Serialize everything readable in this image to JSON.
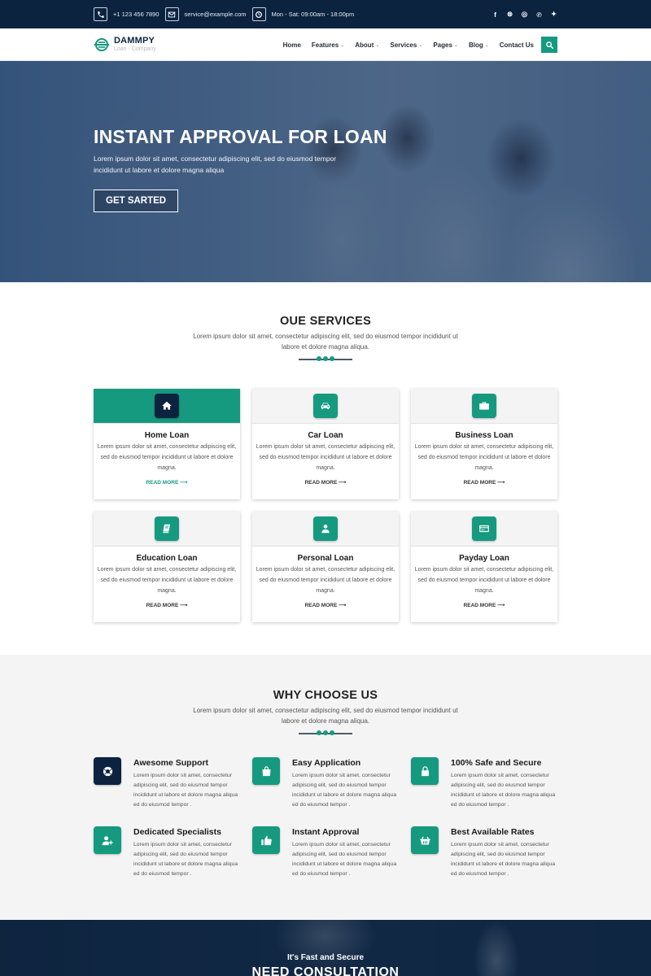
{
  "topbar": {
    "phone": "+1 123 456 7890",
    "email": "service@example.com",
    "hours": "Mon - Sat: 09:00am - 18:00pm",
    "socials": [
      {
        "name": "facebook",
        "glyph": "f"
      },
      {
        "name": "dribbble",
        "glyph": "⊗"
      },
      {
        "name": "instagram",
        "glyph": "◎"
      },
      {
        "name": "pinterest",
        "glyph": "℗"
      },
      {
        "name": "twitter",
        "glyph": "✦"
      }
    ]
  },
  "nav": {
    "brand": "DAMMPY",
    "tagline": "Loan - Company",
    "items": [
      {
        "label": "Home",
        "dropdown": false
      },
      {
        "label": "Features",
        "dropdown": true
      },
      {
        "label": "About",
        "dropdown": true
      },
      {
        "label": "Services",
        "dropdown": true
      },
      {
        "label": "Pages",
        "dropdown": true
      },
      {
        "label": "Blog",
        "dropdown": true
      },
      {
        "label": "Contact Us",
        "dropdown": false
      }
    ],
    "caret": "⌄"
  },
  "hero": {
    "title": "INSTANT APPROVAL FOR LOAN",
    "text": "Lorem ipsum dolor sit amet, consectetur adipiscing elit, sed do eiusmod tempor incididunt ut labore et dolore magna aliqua",
    "cta": "GET SARTED"
  },
  "services": {
    "title": "OUE SERVICES",
    "text": "Lorem ipsum dolor sit amet, consectetur adipiscing elit, sed do eiusmod tempor incididunt ut labore et dolore magna aliqua.",
    "read_more": "READ MORE  ⟶",
    "cards": [
      {
        "title": "Home Loan",
        "icon": "home-icon",
        "active": true,
        "text": "Lorem ipsum dolor sit amet, consectetur adipiscing elit, sed do eiusmod tempor incididunt ut labore et dolore magna."
      },
      {
        "title": "Car Loan",
        "icon": "car-icon",
        "active": false,
        "text": "Lorem ipsum dolor sit amet, consectetur adipiscing elit, sed do eiusmod tempor incididunt ut labore et dolore magna."
      },
      {
        "title": "Business Loan",
        "icon": "briefcase-icon",
        "active": false,
        "text": "Lorem ipsum dolor sit amet, consectetur adipiscing elit, sed do eiusmod tempor incididunt ut labore et dolore magna."
      },
      {
        "title": "Education Loan",
        "icon": "book-icon",
        "active": false,
        "text": "Lorem ipsum dolor sit amet, consectetur adipiscing elit, sed do eiusmod tempor incididunt ut labore et dolore magna."
      },
      {
        "title": "Personal Loan",
        "icon": "user-icon",
        "active": false,
        "text": "Lorem ipsum dolor sit amet, consectetur adipiscing elit, sed do eiusmod tempor incididunt ut labore et dolore magna."
      },
      {
        "title": "Payday Loan",
        "icon": "credit-card-icon",
        "active": false,
        "text": "Lorem ipsum dolor sit amet, consectetur adipiscing elit, sed do eiusmod tempor incididunt ut labore et dolore magna."
      }
    ]
  },
  "why": {
    "title": "WHY CHOOSE US",
    "text": "Lorem ipsum dolor sit amet, consectetur adipiscing elit, sed do eiusmod tempor incididunt ut labore et dolore magna aliqua.",
    "features": [
      {
        "title": "Awesome Support",
        "icon": "lifebuoy-icon",
        "text": "Lorem ipsum dolor sit amet, consectetur adipiscing elit, sed do eiusmod tempor incididunt ut labore et dolore magna aliqua ed do eiusmod tempor ."
      },
      {
        "title": "Easy Application",
        "icon": "shopping-bag-icon",
        "text": "Lorem ipsum dolor sit amet, consectetur adipiscing elit, sed do eiusmod tempor incididunt ut labore et dolore magna aliqua ed do eiusmod tempor ."
      },
      {
        "title": "100% Safe and Secure",
        "icon": "lock-icon",
        "text": "Lorem ipsum dolor sit amet, consectetur adipiscing elit, sed do eiusmod tempor incididunt ut labore et dolore magna aliqua ed do eiusmod tempor ."
      },
      {
        "title": "Dedicated Specialists",
        "icon": "user-plus-icon",
        "text": "Lorem ipsum dolor sit amet, consectetur adipiscing elit, sed do eiusmod tempor incididunt ut labore et dolore magna aliqua ed do eiusmod tempor ."
      },
      {
        "title": "Instant Approval",
        "icon": "thumbs-up-icon",
        "text": "Lorem ipsum dolor sit amet, consectetur adipiscing elit, sed do eiusmod tempor incididunt ut labore et dolore magna aliqua ed do eiusmod tempor ."
      },
      {
        "title": "Best Available Rates",
        "icon": "basket-icon",
        "text": "Lorem ipsum dolor sit amet, consectetur adipiscing elit, sed do eiusmod tempor incididunt ut labore et dolore magna aliqua ed do eiusmod tempor ."
      }
    ]
  },
  "consult": {
    "pretitle": "It's Fast and Secure",
    "title": "NEED CONSULTATION"
  },
  "colors": {
    "navy": "#0c2340",
    "accent": "#159a80",
    "light_bg": "#f4f4f4"
  }
}
